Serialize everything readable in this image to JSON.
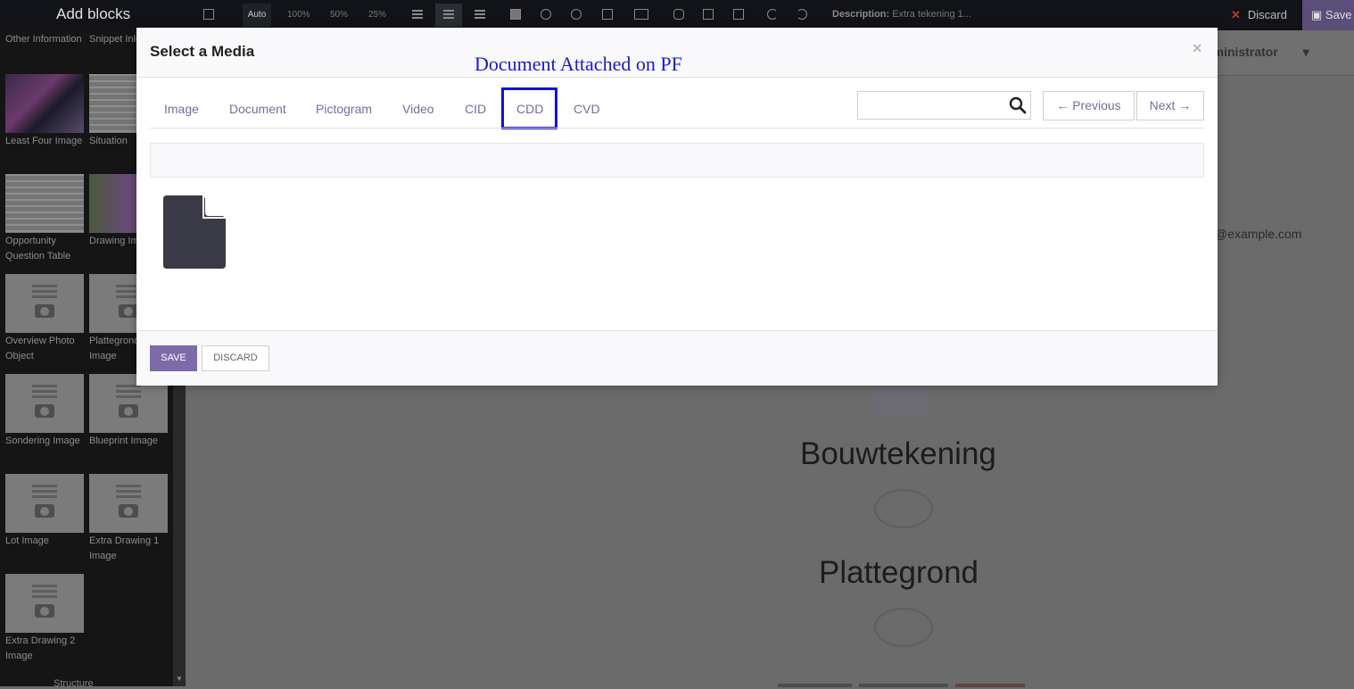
{
  "topbar": {
    "title": "Add blocks",
    "auto_label": "Auto",
    "zoom_100": "100%",
    "zoom_50": "50%",
    "zoom_25": "25%",
    "description_label": "Description:",
    "description_value": "Extra tekening 1...",
    "discard_label": "Discard",
    "save_label": "Save"
  },
  "sidebar": {
    "blocks": [
      {
        "label": "Other Information"
      },
      {
        "label": "Snippet Inleiding"
      },
      {
        "label": "Least Four Image"
      },
      {
        "label": "Situation"
      },
      {
        "label": "Opportunity Question Table"
      },
      {
        "label": "Drawing Image"
      },
      {
        "label": "Overview Photo Object"
      },
      {
        "label": "Plattegrond Image"
      },
      {
        "label": "Sondering Image"
      },
      {
        "label": "Blueprint Image"
      },
      {
        "label": "Lot Image"
      },
      {
        "label": "Extra Drawing 1 Image"
      },
      {
        "label": "Extra Drawing 2 Image"
      }
    ],
    "structure_label": "Structure"
  },
  "background": {
    "admin_label": "Administrator",
    "email": "@example.com",
    "heading_1": "Bouwtekening",
    "heading_2": "Plattegrond"
  },
  "modal": {
    "title": "Select a Media",
    "close_symbol": "×",
    "annotation": "Document Attached on PF",
    "tabs": [
      {
        "label": "Image"
      },
      {
        "label": "Document"
      },
      {
        "label": "Pictogram"
      },
      {
        "label": "Video"
      },
      {
        "label": "CID"
      },
      {
        "label": "CDD"
      },
      {
        "label": "CVD"
      }
    ],
    "active_tab": "CDD",
    "search": {
      "value": "",
      "placeholder": ""
    },
    "previous_label": "← Previous",
    "next_label": "Next →",
    "save_label": "SAVE",
    "discard_label": "DISCARD"
  },
  "colors": {
    "accent": "#7c6aa9",
    "highlight_box": "#1010d8",
    "annotation_text": "#1a1acc"
  }
}
